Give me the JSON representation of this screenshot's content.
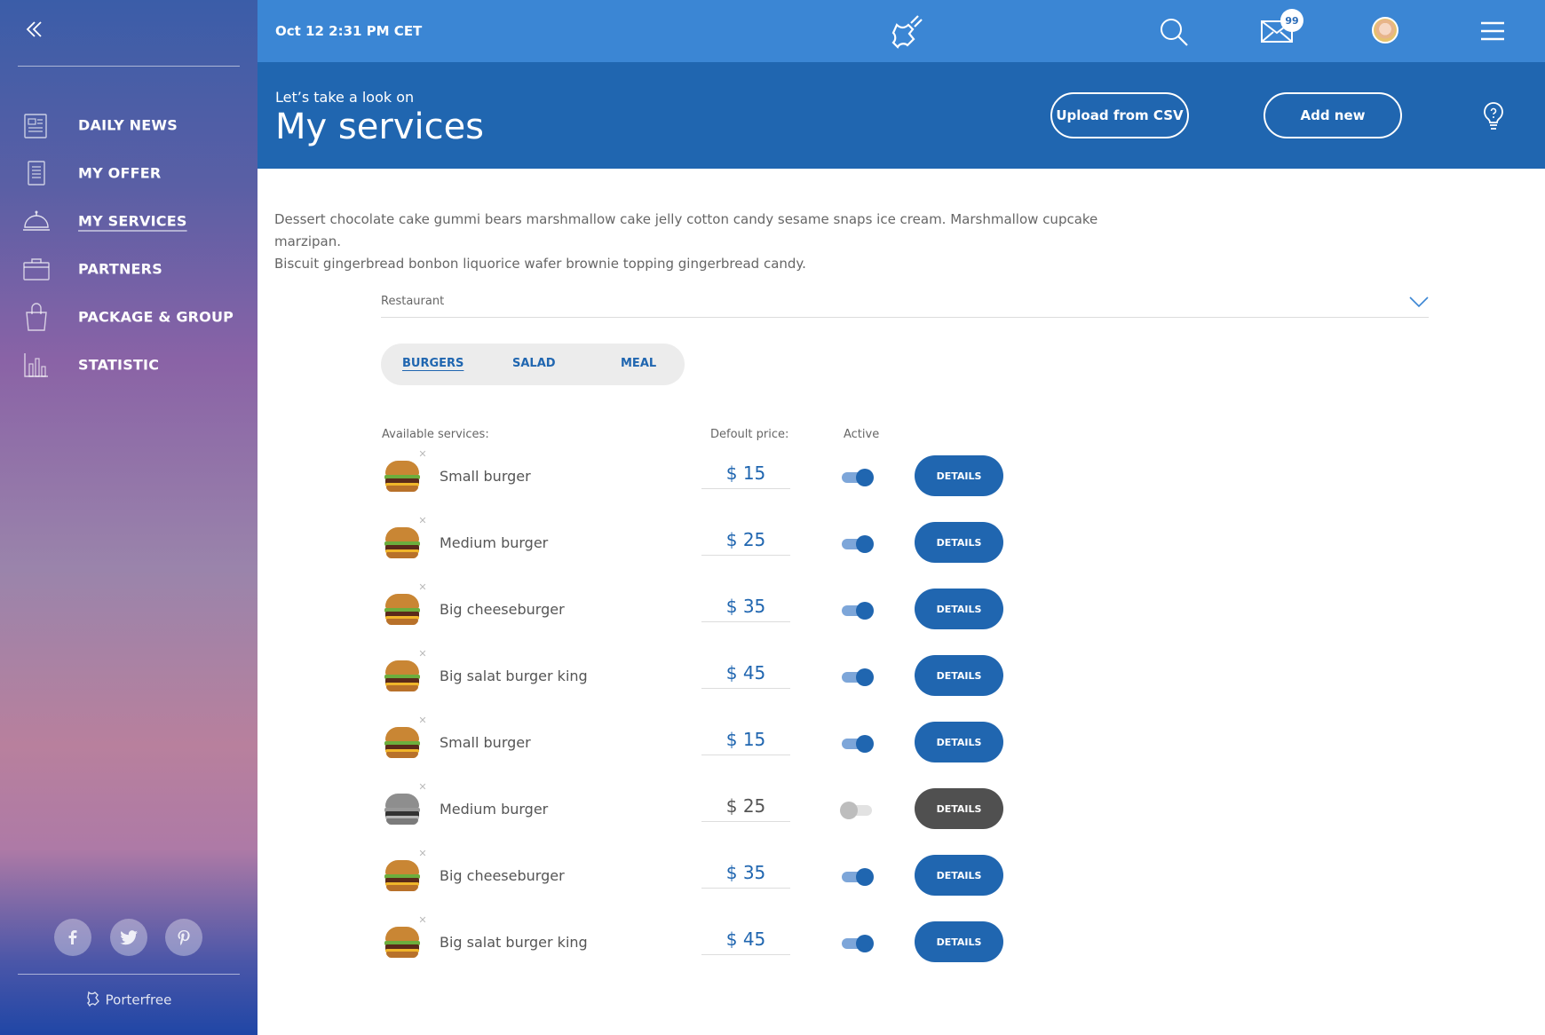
{
  "sidebar": {
    "items": [
      {
        "label": "DAILY NEWS",
        "icon": "newspaper-icon"
      },
      {
        "label": "MY OFFER",
        "icon": "document-icon"
      },
      {
        "label": "MY SERVICES",
        "icon": "cloche-icon",
        "active": true
      },
      {
        "label": "PARTNERS",
        "icon": "briefcase-icon"
      },
      {
        "label": "PACKAGE & GROUP",
        "icon": "shopping-bag-icon"
      },
      {
        "label": "STATISTIC",
        "icon": "bar-chart-icon"
      }
    ],
    "social": [
      "facebook-icon",
      "twitter-icon",
      "pinterest-icon"
    ],
    "brand": "Porterfree"
  },
  "topbar": {
    "datetime": "Oct 12  2:31 PM CET",
    "mail_badge": "99"
  },
  "header": {
    "subtitle": "Let’s take a look on",
    "title": "My services",
    "upload_label": "Upload from CSV",
    "add_label": "Add new"
  },
  "content": {
    "description_line1": "Dessert chocolate cake gummi bears marshmallow cake jelly cotton candy sesame snaps ice cream. Marshmallow cupcake marzipan.",
    "description_line2": "Biscuit gingerbread bonbon liquorice wafer brownie topping gingerbread candy.",
    "category": "Restaurant",
    "tabs": [
      "BURGERS",
      "SALAD",
      "MEAL"
    ],
    "active_tab": "BURGERS",
    "columns": {
      "services": "Available services:",
      "price": "Defoult price:",
      "active": "Active"
    },
    "details_label": "DETAILS",
    "services": [
      {
        "name": "Small burger",
        "price": "$ 15",
        "active": true
      },
      {
        "name": "Medium burger",
        "price": "$ 25",
        "active": true
      },
      {
        "name": "Big cheeseburger",
        "price": "$ 35",
        "active": true
      },
      {
        "name": "Big salat burger king",
        "price": "$ 45",
        "active": true
      },
      {
        "name": "Small burger",
        "price": "$ 15",
        "active": true
      },
      {
        "name": "Medium burger",
        "price": "$ 25",
        "active": false
      },
      {
        "name": "Big cheeseburger",
        "price": "$ 35",
        "active": true
      },
      {
        "name": "Big salat burger king",
        "price": "$ 45",
        "active": true
      }
    ]
  },
  "colors": {
    "topbar": "#3b86d4",
    "header": "#2066b0",
    "accent": "#2066b0",
    "inactive_button": "#505050"
  }
}
